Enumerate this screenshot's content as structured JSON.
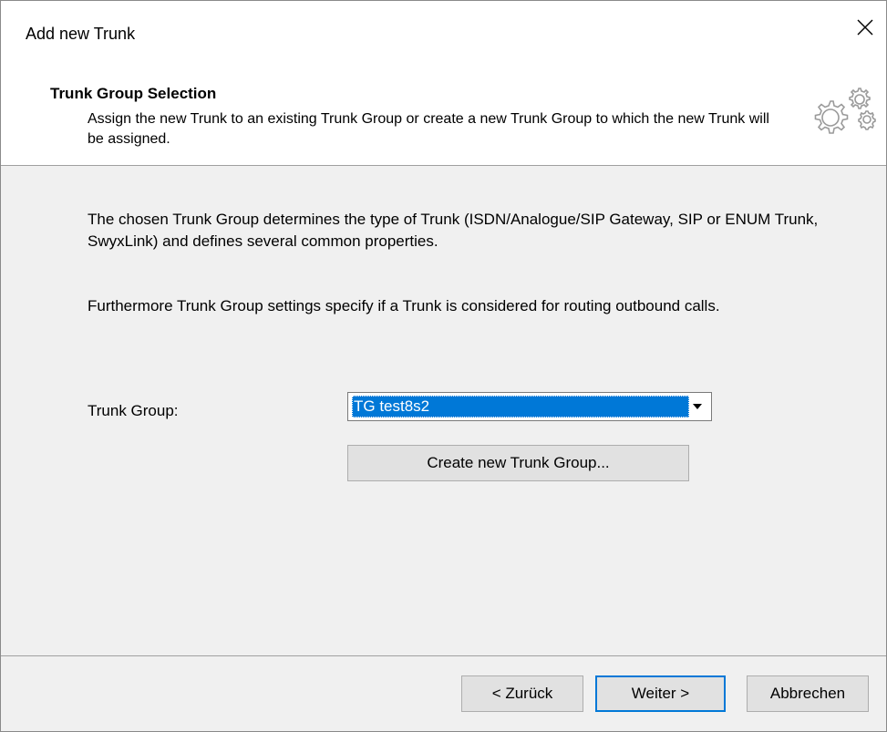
{
  "window": {
    "title": "Add new Trunk",
    "close_icon": "close-icon"
  },
  "header": {
    "title": "Trunk Group Selection",
    "description": "Assign the new Trunk to an existing Trunk Group or create a new Trunk Group to which the new Trunk will be assigned.",
    "icon": "gears-icon"
  },
  "body": {
    "paragraph1": "The chosen Trunk Group determines the type of Trunk (ISDN/Analogue/SIP Gateway, SIP or ENUM Trunk, SwyxLink) and defines several common properties.",
    "paragraph2": "Furthermore Trunk Group settings specify if a Trunk is considered for routing outbound calls."
  },
  "form": {
    "trunk_group_label": "Trunk Group:",
    "trunk_group_value": "TG test8s2",
    "create_button": "Create new Trunk Group..."
  },
  "footer": {
    "back_button": "< Zurück",
    "next_button": "Weiter >",
    "cancel_button": "Abbrechen"
  },
  "colors": {
    "selection": "#0078d7",
    "dialog_bg": "#f0f0f0",
    "header_bg": "#ffffff"
  }
}
